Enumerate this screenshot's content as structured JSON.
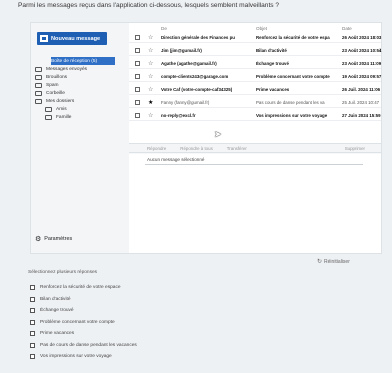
{
  "question": "Parmi les messages reçus dans l'application ci-dessous, lesquels semblent malveillants ?",
  "sidebar": {
    "new_message": "Nouveau message",
    "folders": [
      {
        "label": "Boîte de réception (5)"
      },
      {
        "label": "Messages envoyés"
      },
      {
        "label": "Brouillons"
      },
      {
        "label": "Spam"
      },
      {
        "label": "Corbeille"
      },
      {
        "label": "Mes dossiers"
      },
      {
        "label": "Amis"
      },
      {
        "label": "Famille"
      }
    ],
    "settings": "Paramètres"
  },
  "list": {
    "headers": {
      "from": "De",
      "subject": "Objet",
      "date": "Date"
    },
    "rows": [
      {
        "from": "Direction générale des Finances pu",
        "subject": "Renforcez la sécurité de votre espa",
        "date": "26 Août 2024 18:03"
      },
      {
        "from": "Jim (jim@gumail.fr)",
        "subject": "Bilan d'activité",
        "date": "23 Août 2024 10:54"
      },
      {
        "from": "Agathe (agathe@gamail.fr)",
        "subject": "Échange trouvé",
        "date": "23 Août 2024 11:09"
      },
      {
        "from": "compte-clients243@garage.com",
        "subject": "Problème concernant votre compte",
        "date": "19 Août 2024 09:57"
      },
      {
        "from": "Votre Caf (votre-compte-caf34325)",
        "subject": "Prime vacances",
        "date": "26 Juil. 2024 11:06"
      },
      {
        "from": "Fanny (fanny@gumail.fr)",
        "subject": "Pas cours de danse pendant les va",
        "date": "25 Juil. 2024 10:47"
      },
      {
        "from": "no-reply@excl.fr",
        "subject": "Vos impressions sur votre voyage",
        "date": "27 Juin 2024 15:59"
      }
    ],
    "attachment_icon": "paperclip-icon"
  },
  "toolbar": {
    "reply": "Répondre",
    "reply_all": "Répondre à tous",
    "forward": "Transférer",
    "close": "Supprimer"
  },
  "preview": {
    "empty": "Aucun message sélectionné"
  },
  "reset": "Réinitialiser",
  "answers": {
    "hint": "Sélectionnez plusieurs réponses",
    "options": [
      "Renforcez la sécurité de votre espace",
      "Bilan d'activité",
      "Échange trouvé",
      "Problème concernant votre compte",
      "Prime vacances",
      "Pas de cours de danse pendant les vacances",
      "Vos impressions sur votre voyage"
    ]
  },
  "colors": {
    "accent": "#1e5fb3",
    "selected_folder": "#2f6fc6"
  }
}
